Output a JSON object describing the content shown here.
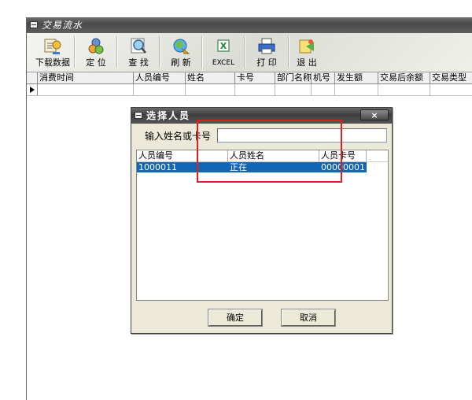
{
  "main_window": {
    "title": "交易流水"
  },
  "toolbar": {
    "buttons": [
      {
        "label": "下载数据",
        "icon": "download-data-icon"
      },
      {
        "label": "定 位",
        "icon": "locate-icon"
      },
      {
        "label": "查 找",
        "icon": "find-icon"
      },
      {
        "label": "刷 新",
        "icon": "refresh-icon"
      },
      {
        "label": "EXCEL",
        "icon": "excel-icon"
      },
      {
        "label": "打 印",
        "icon": "printer-icon"
      },
      {
        "label": "退 出",
        "icon": "exit-icon"
      }
    ]
  },
  "grid": {
    "columns": [
      "消费时间",
      "人员编号",
      "姓名",
      "卡号",
      "部门名称",
      "机号",
      "发生额",
      "交易后余额",
      "交易类型"
    ]
  },
  "dialog": {
    "title": "选择人员",
    "close_label": "×",
    "search_label": "输入姓名或卡号",
    "search_value": "",
    "columns": [
      "人员编号",
      "人员姓名",
      "人员卡号"
    ],
    "rows": [
      {
        "id": "1000011",
        "name": "正在",
        "card": "00000001"
      }
    ],
    "ok_label": "确定",
    "cancel_label": "取消"
  },
  "colors": {
    "selection": "#1266b5",
    "highlight_box": "#e02020",
    "titlebar": "#4a4a4a"
  }
}
